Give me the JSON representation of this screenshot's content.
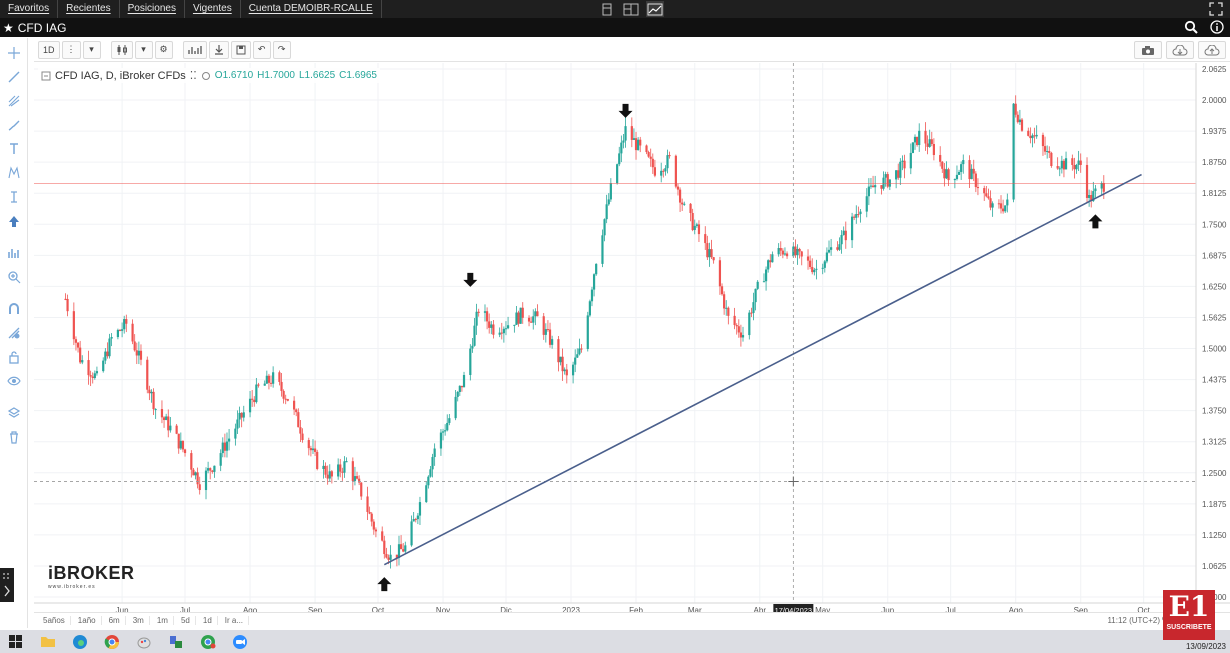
{
  "menu": {
    "items": [
      "Favoritos",
      "Recientes",
      "Posiciones",
      "Vigentes",
      "Cuenta DEMOIBR-RCALLE"
    ]
  },
  "title_bar": {
    "title": "CFD IAG"
  },
  "toolbar": {
    "interval": "1D"
  },
  "legend": {
    "symbol": "CFD IAG, D, iBroker CFDs",
    "open": "O1.6710",
    "high": "H1.7000",
    "low": "L1.6625",
    "close": "C1.6965"
  },
  "watermark": {
    "brand": "iBROKER",
    "url": "www.ibroker.es"
  },
  "range_buttons": [
    "5años",
    "1año",
    "6m",
    "3m",
    "1m",
    "5d",
    "1d",
    "Ir a..."
  ],
  "status": {
    "time": "11:12 (UTC+2)",
    "percent": "%"
  },
  "taskbar": {
    "date": "13/09/2023"
  },
  "badge": {
    "logo": "E1",
    "label": "SUSCRIBETE"
  },
  "colors": {
    "up": "#26a69a",
    "down": "#ef5350",
    "trendline": "#4a5f8c",
    "price_line": "#ef5350",
    "price_tag": "#ef5350"
  },
  "chart_data": {
    "type": "candlestick",
    "symbol": "CFD IAG",
    "timeframe": "D",
    "x_axis_labels": [
      "Jun",
      "Jul",
      "Ago",
      "Sep",
      "Oct",
      "Nov",
      "Dic",
      "2023",
      "Feb",
      "Mar",
      "Abr",
      "17/04/2023",
      "May",
      "Jun",
      "Jul",
      "Ago",
      "Sep",
      "Oct"
    ],
    "y_ticks": [
      "2.0625",
      "2.0000",
      "1.9375",
      "1.8750",
      "1.8125",
      "1.7500",
      "1.6875",
      "1.6250",
      "1.5625",
      "1.5000",
      "1.4375",
      "1.3750",
      "1.3125",
      "1.2500",
      "1.1875",
      "1.1250",
      "1.0625",
      "1.0000"
    ],
    "ylim": [
      1.0,
      2.0625
    ],
    "current_price": "1.8325",
    "crosshair_price": "1.2325",
    "crosshair_date": "17/04/2023",
    "close_path": [
      {
        "date": "2022-05-05",
        "value": 1.6
      },
      {
        "date": "2022-05-12",
        "value": 1.48
      },
      {
        "date": "2022-05-20",
        "value": 1.44
      },
      {
        "date": "2022-05-27",
        "value": 1.52
      },
      {
        "date": "2022-06-03",
        "value": 1.55
      },
      {
        "date": "2022-06-10",
        "value": 1.47
      },
      {
        "date": "2022-06-17",
        "value": 1.38
      },
      {
        "date": "2022-06-24",
        "value": 1.34
      },
      {
        "date": "2022-07-01",
        "value": 1.29
      },
      {
        "date": "2022-07-08",
        "value": 1.23
      },
      {
        "date": "2022-07-15",
        "value": 1.27
      },
      {
        "date": "2022-07-22",
        "value": 1.32
      },
      {
        "date": "2022-07-29",
        "value": 1.37
      },
      {
        "date": "2022-08-05",
        "value": 1.42
      },
      {
        "date": "2022-08-12",
        "value": 1.44
      },
      {
        "date": "2022-08-19",
        "value": 1.4
      },
      {
        "date": "2022-08-26",
        "value": 1.33
      },
      {
        "date": "2022-09-02",
        "value": 1.27
      },
      {
        "date": "2022-09-09",
        "value": 1.24
      },
      {
        "date": "2022-09-16",
        "value": 1.27
      },
      {
        "date": "2022-09-23",
        "value": 1.21
      },
      {
        "date": "2022-09-30",
        "value": 1.13
      },
      {
        "date": "2022-10-07",
        "value": 1.08
      },
      {
        "date": "2022-10-14",
        "value": 1.1
      },
      {
        "date": "2022-10-21",
        "value": 1.19
      },
      {
        "date": "2022-10-28",
        "value": 1.3
      },
      {
        "date": "2022-11-04",
        "value": 1.36
      },
      {
        "date": "2022-11-11",
        "value": 1.44
      },
      {
        "date": "2022-11-18",
        "value": 1.58
      },
      {
        "date": "2022-11-25",
        "value": 1.54
      },
      {
        "date": "2022-12-02",
        "value": 1.55
      },
      {
        "date": "2022-12-09",
        "value": 1.57
      },
      {
        "date": "2022-12-16",
        "value": 1.56
      },
      {
        "date": "2022-12-23",
        "value": 1.51
      },
      {
        "date": "2022-12-30",
        "value": 1.44
      },
      {
        "date": "2023-01-06",
        "value": 1.5
      },
      {
        "date": "2023-01-13",
        "value": 1.68
      },
      {
        "date": "2023-01-20",
        "value": 1.82
      },
      {
        "date": "2023-01-27",
        "value": 1.94
      },
      {
        "date": "2023-02-03",
        "value": 1.9
      },
      {
        "date": "2023-02-10",
        "value": 1.86
      },
      {
        "date": "2023-02-17",
        "value": 1.88
      },
      {
        "date": "2023-02-24",
        "value": 1.78
      },
      {
        "date": "2023-03-03",
        "value": 1.73
      },
      {
        "date": "2023-03-10",
        "value": 1.67
      },
      {
        "date": "2023-03-17",
        "value": 1.56
      },
      {
        "date": "2023-03-24",
        "value": 1.53
      },
      {
        "date": "2023-03-31",
        "value": 1.62
      },
      {
        "date": "2023-04-07",
        "value": 1.69
      },
      {
        "date": "2023-04-14",
        "value": 1.7
      },
      {
        "date": "2023-04-21",
        "value": 1.68
      },
      {
        "date": "2023-04-28",
        "value": 1.66
      },
      {
        "date": "2023-05-05",
        "value": 1.7
      },
      {
        "date": "2023-05-12",
        "value": 1.73
      },
      {
        "date": "2023-05-19",
        "value": 1.79
      },
      {
        "date": "2023-05-26",
        "value": 1.83
      },
      {
        "date": "2023-06-02",
        "value": 1.84
      },
      {
        "date": "2023-06-09",
        "value": 1.87
      },
      {
        "date": "2023-06-16",
        "value": 1.93
      },
      {
        "date": "2023-06-23",
        "value": 1.9
      },
      {
        "date": "2023-06-30",
        "value": 1.84
      },
      {
        "date": "2023-07-07",
        "value": 1.87
      },
      {
        "date": "2023-07-14",
        "value": 1.83
      },
      {
        "date": "2023-07-21",
        "value": 1.78
      },
      {
        "date": "2023-07-28",
        "value": 1.79
      },
      {
        "date": "2023-07-31",
        "value": 1.99
      },
      {
        "date": "2023-08-04",
        "value": 1.95
      },
      {
        "date": "2023-08-11",
        "value": 1.92
      },
      {
        "date": "2023-08-18",
        "value": 1.88
      },
      {
        "date": "2023-08-25",
        "value": 1.87
      },
      {
        "date": "2023-09-01",
        "value": 1.87
      },
      {
        "date": "2023-09-05",
        "value": 1.8
      },
      {
        "date": "2023-09-12",
        "value": 1.83
      }
    ],
    "trendline": [
      {
        "date": "2022-10-04",
        "value": 1.065
      },
      {
        "date": "2023-09-30",
        "value": 1.85
      }
    ],
    "markers": [
      {
        "type": "arrow-up",
        "date": "2022-10-04",
        "value": 1.06
      },
      {
        "type": "arrow-down",
        "date": "2022-11-14",
        "value": 1.61
      },
      {
        "type": "arrow-down",
        "date": "2023-01-27",
        "value": 1.95
      },
      {
        "type": "arrow-up",
        "date": "2023-09-08",
        "value": 1.79
      }
    ]
  }
}
